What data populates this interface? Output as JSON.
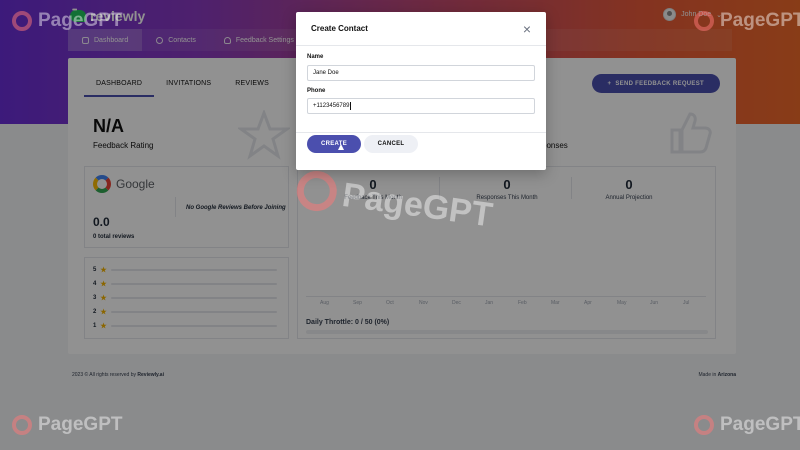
{
  "brand": {
    "name": "reviewly",
    "accent": "#4b4fae"
  },
  "user": {
    "name": "John Doe",
    "chevron": "⌄"
  },
  "topnav": [
    {
      "label": "Dashboard",
      "icon": "home-icon"
    },
    {
      "label": "Contacts",
      "icon": "user-icon"
    },
    {
      "label": "Feedback Settings",
      "icon": "lightbulb-icon"
    }
  ],
  "tabs": [
    "DASHBOARD",
    "INVITATIONS",
    "REVIEWS"
  ],
  "send_button": "SEND FEEDBACK REQUEST",
  "stats": {
    "rating_value": "N/A",
    "rating_label": "Feedback Rating",
    "responses_label": "sponses"
  },
  "google": {
    "label": "Google",
    "score": "0.0",
    "total": "0 total reviews",
    "note": "No Google Reviews Before Joining",
    "stars": [
      "5",
      "4",
      "3",
      "2",
      "1"
    ],
    "star_levels": [
      0,
      0,
      0,
      0,
      0
    ]
  },
  "kpis": [
    {
      "value": "0",
      "label": "Feedback This Month"
    },
    {
      "value": "0",
      "label": "Responses This Month"
    },
    {
      "value": "0",
      "label": "Annual Projection"
    }
  ],
  "months": [
    "Aug",
    "Sep",
    "Oct",
    "Nov",
    "Dec",
    "Jan",
    "Feb",
    "Mar",
    "Apr",
    "May",
    "Jun",
    "Jul"
  ],
  "throttle": "Daily Throttle: 0 / 50 (0%)",
  "footer": {
    "copyright": "2023 © All rights reserved by",
    "company": "Reviewly.ai",
    "made_in_prefix": "Made in",
    "made_in_place": "Arizona"
  },
  "watermark": "PageGPT",
  "modal": {
    "title": "Create Contact",
    "name_label": "Name",
    "name_value": "Jane Doe",
    "phone_label": "Phone",
    "phone_value": "+1123456789",
    "create": "CREATE",
    "cancel": "CANCEL",
    "close_icon": "close-icon"
  }
}
